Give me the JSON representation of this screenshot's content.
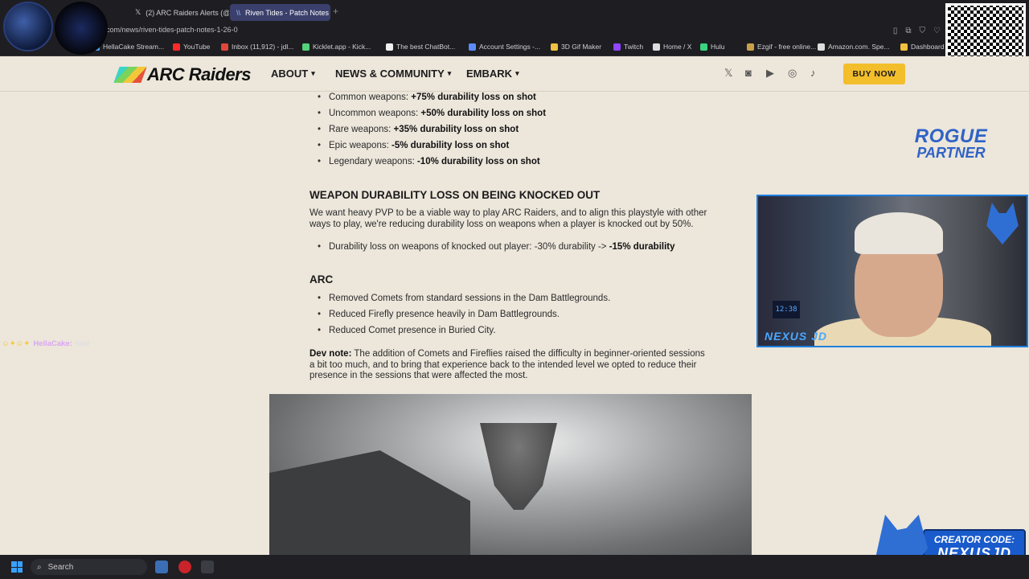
{
  "browser": {
    "tabs": [
      {
        "label": "(2) ARC Raiders Alerts (@"
      },
      {
        "label": "Riven Tides - Patch Notes"
      }
    ],
    "url": "com/news/riven-tides-patch-notes-1-26-0",
    "bookmarks": [
      {
        "label": "HellaCake Stream...",
        "color": "#4fa3ff"
      },
      {
        "label": "YouTube",
        "color": "#ff2b2b"
      },
      {
        "label": "Inbox (11,912) - jdl...",
        "color": "#e0463a"
      },
      {
        "label": "Kicklet.app - Kick...",
        "color": "#55d17a"
      },
      {
        "label": "The best ChatBot...",
        "color": "#f0f0f0"
      },
      {
        "label": "Account Settings -...",
        "color": "#5b8cff"
      },
      {
        "label": "3D Gif Maker",
        "color": "#f0c040"
      },
      {
        "label": "Twitch",
        "color": "#9146ff"
      },
      {
        "label": "Home / X",
        "color": "#dddddd"
      },
      {
        "label": "Hulu",
        "color": "#3ad37f"
      },
      {
        "label": "Ezgif - free online...",
        "color": "#c9a14a"
      },
      {
        "label": "Amazon.com. Spe...",
        "color": "#dddddd"
      },
      {
        "label": "Dashboard",
        "color": "#f0c040"
      }
    ]
  },
  "site": {
    "logo_text": "ARC Raiders",
    "nav": [
      {
        "label": "ABOUT"
      },
      {
        "label": "NEWS & COMMUNITY"
      },
      {
        "label": "EMBARK"
      }
    ],
    "social_icons": [
      "x-icon",
      "discord-icon",
      "youtube-icon",
      "instagram-icon",
      "tiktok-icon"
    ],
    "buy_label": "BUY NOW",
    "accent": "#f3be2b"
  },
  "article": {
    "weapon_rarity": [
      {
        "prefix": "Common weapons: ",
        "value": "+75% durability loss on shot"
      },
      {
        "prefix": "Uncommon weapons: ",
        "value": "+50% durability loss on shot"
      },
      {
        "prefix": "Rare weapons: ",
        "value": "+35% durability loss on shot"
      },
      {
        "prefix": "Epic weapons: ",
        "value": "-5% durability loss on shot"
      },
      {
        "prefix": "Legendary weapons: ",
        "value": "-10% durability loss on shot"
      }
    ],
    "section1_heading": "WEAPON DURABILITY LOSS ON BEING KNOCKED OUT",
    "section1_para": "We want heavy PVP to be a viable way to play ARC Raiders, and to align this playstyle with other ways to play, we're reducing durability loss on weapons when a player is knocked out by 50%.",
    "section1_bullet_prefix": "Durability loss on weapons of knocked out player: -30% durability -> ",
    "section1_bullet_value": "-15% durability",
    "section2_heading": "ARC",
    "section2_bullets": [
      "Removed Comets from standard sessions in the Dam Battlegrounds.",
      "Reduced Firefly presence heavily in Dam Battlegrounds.",
      "Reduced Comet presence in Buried City."
    ],
    "dev_note_label": "Dev note:",
    "dev_note_text": " The addition of Comets and Fireflies raised the difficulty in beginner-oriented sessions a bit too much, and to bring that experience back to the intended level we opted to reduce their presence in the sessions that were affected the most."
  },
  "overlay": {
    "rogue_line1": "ROGUE",
    "rogue_line2": "PARTNER",
    "webcam_name": "NEXUS JD",
    "webcam_clock": "12:38",
    "chat_user": "HellaCake:",
    "chat_msg": "lolol",
    "creator_line1": "CREATOR CODE:",
    "creator_line2": "NEXUSJD"
  },
  "taskbar": {
    "search_placeholder": "Search"
  }
}
